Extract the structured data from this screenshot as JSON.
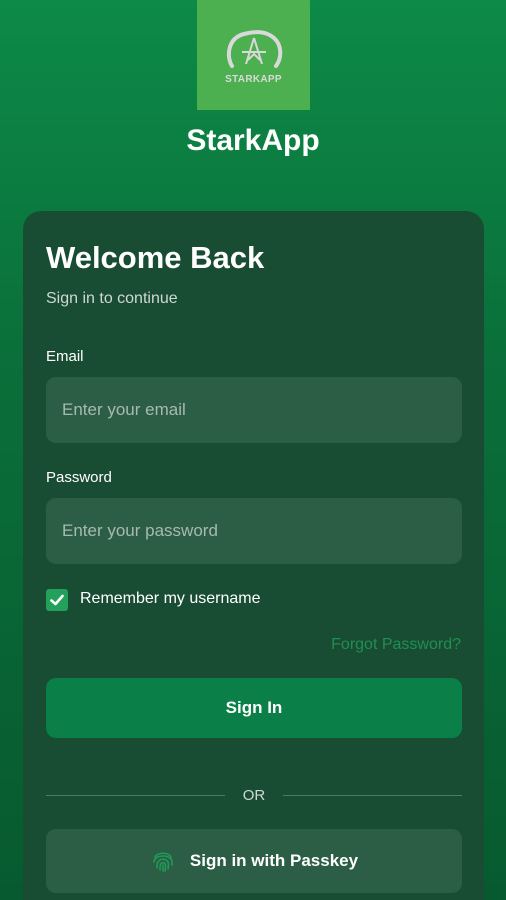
{
  "brand": {
    "logo_text": "STARKAPP",
    "app_name": "StarkApp"
  },
  "login": {
    "title": "Welcome Back",
    "subtitle": "Sign in to continue",
    "email_label": "Email",
    "email_placeholder": "Enter your email",
    "email_value": "",
    "password_label": "Password",
    "password_placeholder": "Enter your password",
    "password_value": "",
    "remember_label": "Remember my username",
    "remember_checked": true,
    "forgot_label": "Forgot Password?",
    "signin_label": "Sign In",
    "divider_label": "OR",
    "passkey_label": "Sign in with Passkey"
  },
  "icons": {
    "logo": "star-logo-icon",
    "checkbox": "checkmark-icon",
    "passkey": "fingerprint-icon"
  },
  "colors": {
    "background": "#0a6f3a",
    "card": "#194d33",
    "field": "#2c5e45",
    "primary_button": "#0a7f47",
    "checkbox": "#23a05a",
    "link": "#1f8f52",
    "logo_box": "#4caf50"
  }
}
